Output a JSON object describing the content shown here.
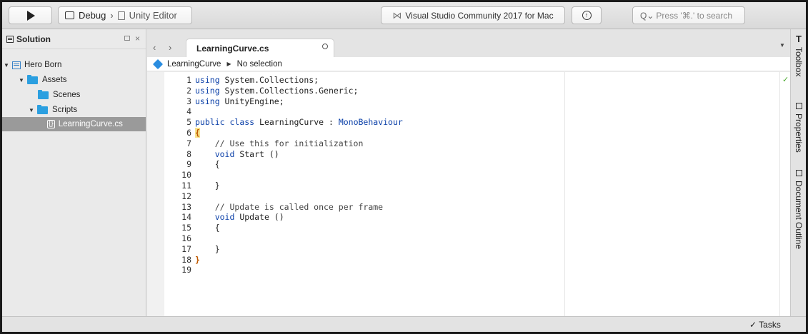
{
  "toolbar": {
    "configuration": "Debug",
    "separator": "›",
    "target": "Unity Editor",
    "status": "Visual Studio Community 2017 for Mac",
    "search_placeholder": "Press '⌘.' to search"
  },
  "solution": {
    "title": "Solution",
    "tree": [
      {
        "label": "Hero Born",
        "icon": "project-icon",
        "expanded": true
      },
      {
        "label": "Assets",
        "icon": "folder-icon",
        "expanded": true
      },
      {
        "label": "Scenes",
        "icon": "folder-icon",
        "expanded": false
      },
      {
        "label": "Scripts",
        "icon": "folder-icon",
        "expanded": true
      },
      {
        "label": "LearningCurve.cs",
        "icon": "csharp-file-icon",
        "selected": true
      }
    ]
  },
  "editor": {
    "tab_title": "LearningCurve.cs",
    "breadcrumb_class": "LearningCurve",
    "breadcrumb_member": "No selection",
    "lines": [
      {
        "n": "1",
        "text": "using System.Collections;"
      },
      {
        "n": "2",
        "text": "using System.Collections.Generic;"
      },
      {
        "n": "3",
        "text": "using UnityEngine;"
      },
      {
        "n": "4",
        "text": ""
      },
      {
        "n": "5",
        "text": "public class LearningCurve : MonoBehaviour"
      },
      {
        "n": "6",
        "text": "{"
      },
      {
        "n": "7",
        "text": "    // Use this for initialization"
      },
      {
        "n": "8",
        "text": "    void Start ()"
      },
      {
        "n": "9",
        "text": "    {"
      },
      {
        "n": "10",
        "text": ""
      },
      {
        "n": "11",
        "text": "    }"
      },
      {
        "n": "12",
        "text": ""
      },
      {
        "n": "13",
        "text": "    // Update is called once per frame"
      },
      {
        "n": "14",
        "text": "    void Update ()"
      },
      {
        "n": "15",
        "text": "    {"
      },
      {
        "n": "16",
        "text": ""
      },
      {
        "n": "17",
        "text": "    }"
      },
      {
        "n": "18",
        "text": "}"
      },
      {
        "n": "19",
        "text": ""
      }
    ]
  },
  "right_dock": {
    "toolbox": "Toolbox",
    "properties": "Properties",
    "document_outline": "Document Outline"
  },
  "statusbar": {
    "tasks": "✓ Tasks"
  },
  "colors": {
    "keyword": "#0a3fa8",
    "folder": "#2b9fe0",
    "selection": "#9a9a9a",
    "brace_highlight": "#f8e38c"
  }
}
